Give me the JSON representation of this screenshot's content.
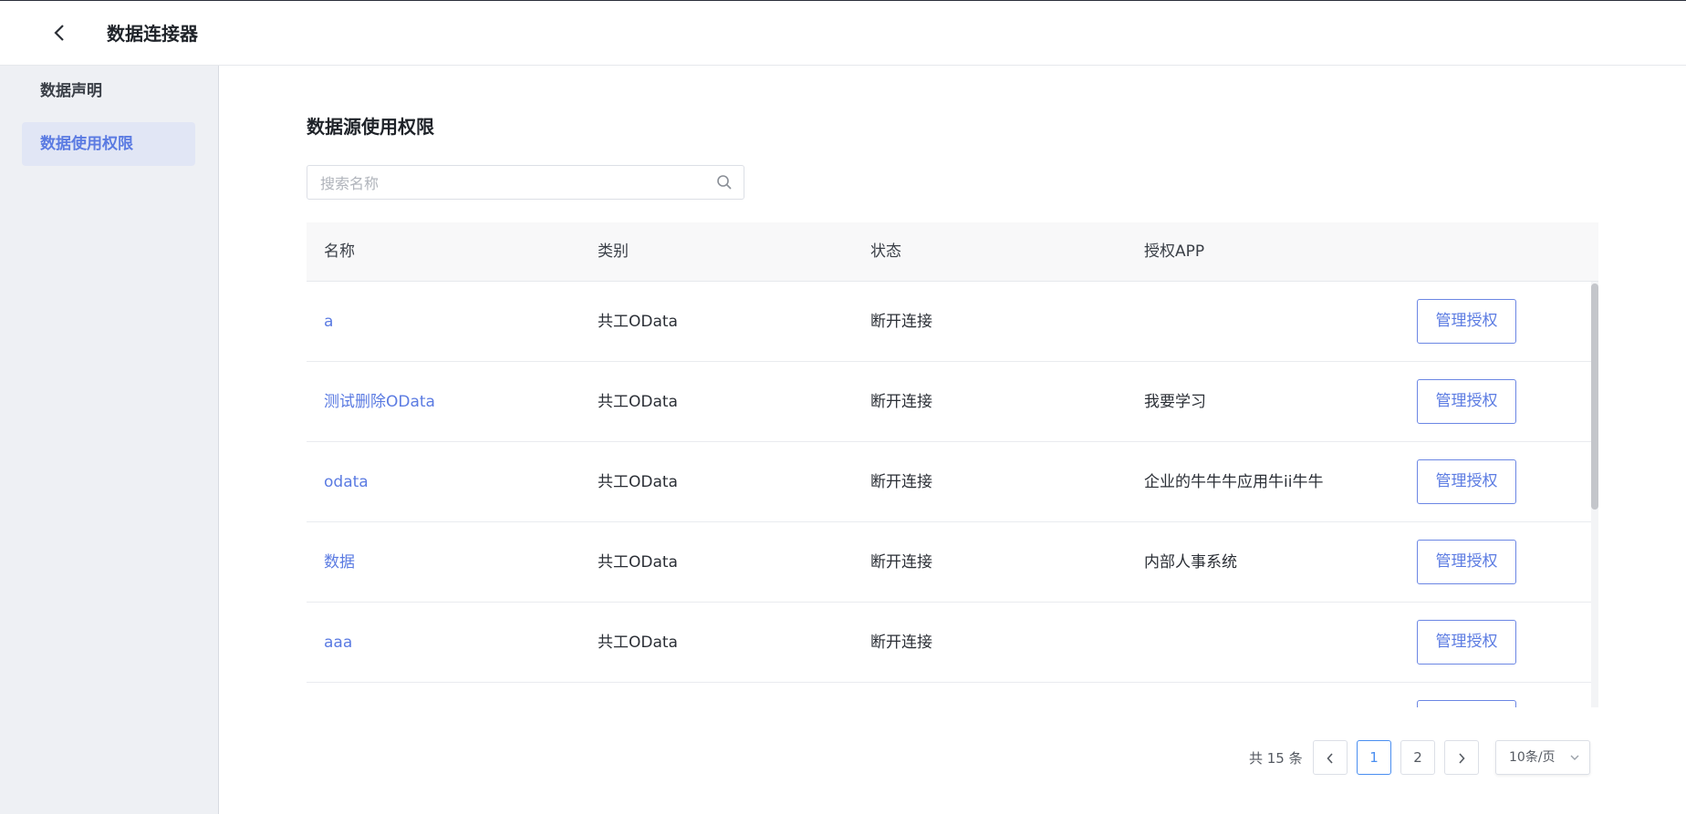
{
  "header": {
    "title": "数据连接器",
    "back_icon": "chevron-left-icon"
  },
  "sidebar": {
    "items": [
      {
        "label": "数据声明",
        "active": false
      },
      {
        "label": "数据使用权限",
        "active": true
      }
    ]
  },
  "main": {
    "title": "数据源使用权限",
    "search": {
      "placeholder": "搜索名称",
      "value": "",
      "icon": "search-icon"
    },
    "table": {
      "columns": [
        "名称",
        "类别",
        "状态",
        "授权APP",
        ""
      ],
      "rows": [
        {
          "name": "a",
          "category": "共工OData",
          "status": "断开连接",
          "app": "",
          "action": "管理授权"
        },
        {
          "name": "测试删除OData",
          "category": "共工OData",
          "status": "断开连接",
          "app": "我要学习",
          "action": "管理授权"
        },
        {
          "name": "odata",
          "category": "共工OData",
          "status": "断开连接",
          "app": "企业的牛牛牛应用牛ii牛牛",
          "action": "管理授权"
        },
        {
          "name": "数据",
          "category": "共工OData",
          "status": "断开连接",
          "app": "内部人事系统",
          "action": "管理授权"
        },
        {
          "name": "aaa",
          "category": "共工OData",
          "status": "断开连接",
          "app": "",
          "action": "管理授权"
        }
      ]
    },
    "pagination": {
      "total_text": "共 15 条",
      "pages": [
        "1",
        "2"
      ],
      "current_page": "1",
      "page_size": "10条/页"
    }
  },
  "colors": {
    "accent": "#5b7be2",
    "active_page": "#4a8ef0",
    "sidebar_bg": "#eef0f4"
  }
}
